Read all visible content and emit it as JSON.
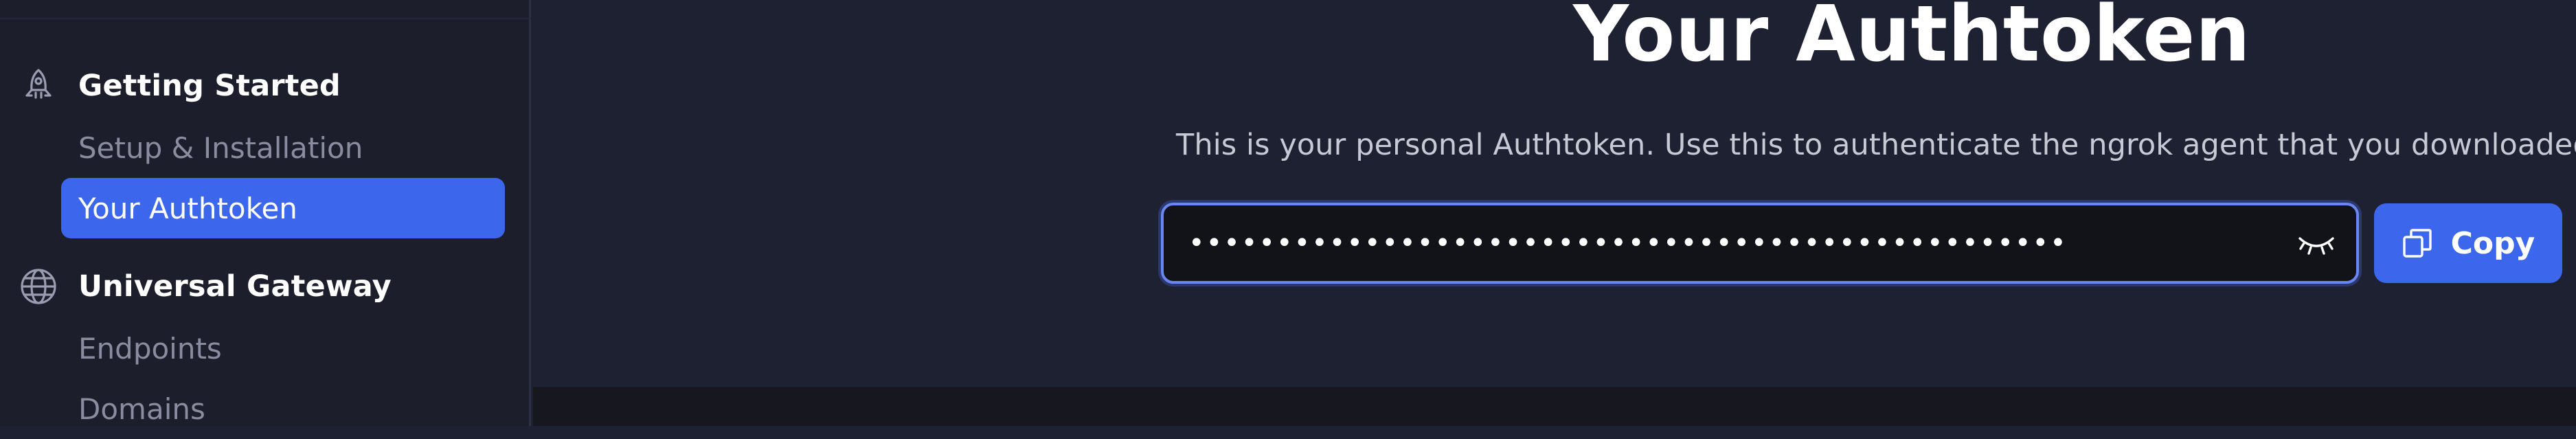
{
  "sidebar": {
    "sections": [
      {
        "title": "Getting Started",
        "icon": "rocket-icon",
        "items": [
          {
            "label": "Setup & Installation",
            "active": false
          },
          {
            "label": "Your Authtoken",
            "active": true
          }
        ]
      },
      {
        "title": "Universal Gateway",
        "icon": "globe-icon",
        "items": [
          {
            "label": "Endpoints",
            "active": false
          },
          {
            "label": "Domains",
            "active": false
          }
        ]
      }
    ]
  },
  "main": {
    "title": "Your Authtoken",
    "description": "This is your personal Authtoken. Use this to authenticate the ngrok agent that you downloaded.",
    "token": {
      "masked_value": "••••••••••••••••••••••••••••••••••••••••••••••••••",
      "reveal_icon": "eye-closed-icon"
    },
    "copy_button": {
      "label": "Copy",
      "icon": "copy-icon"
    }
  },
  "colors": {
    "accent": "#3c67ec",
    "background": "#1e2132",
    "sidebar": "#1c1e2c"
  }
}
